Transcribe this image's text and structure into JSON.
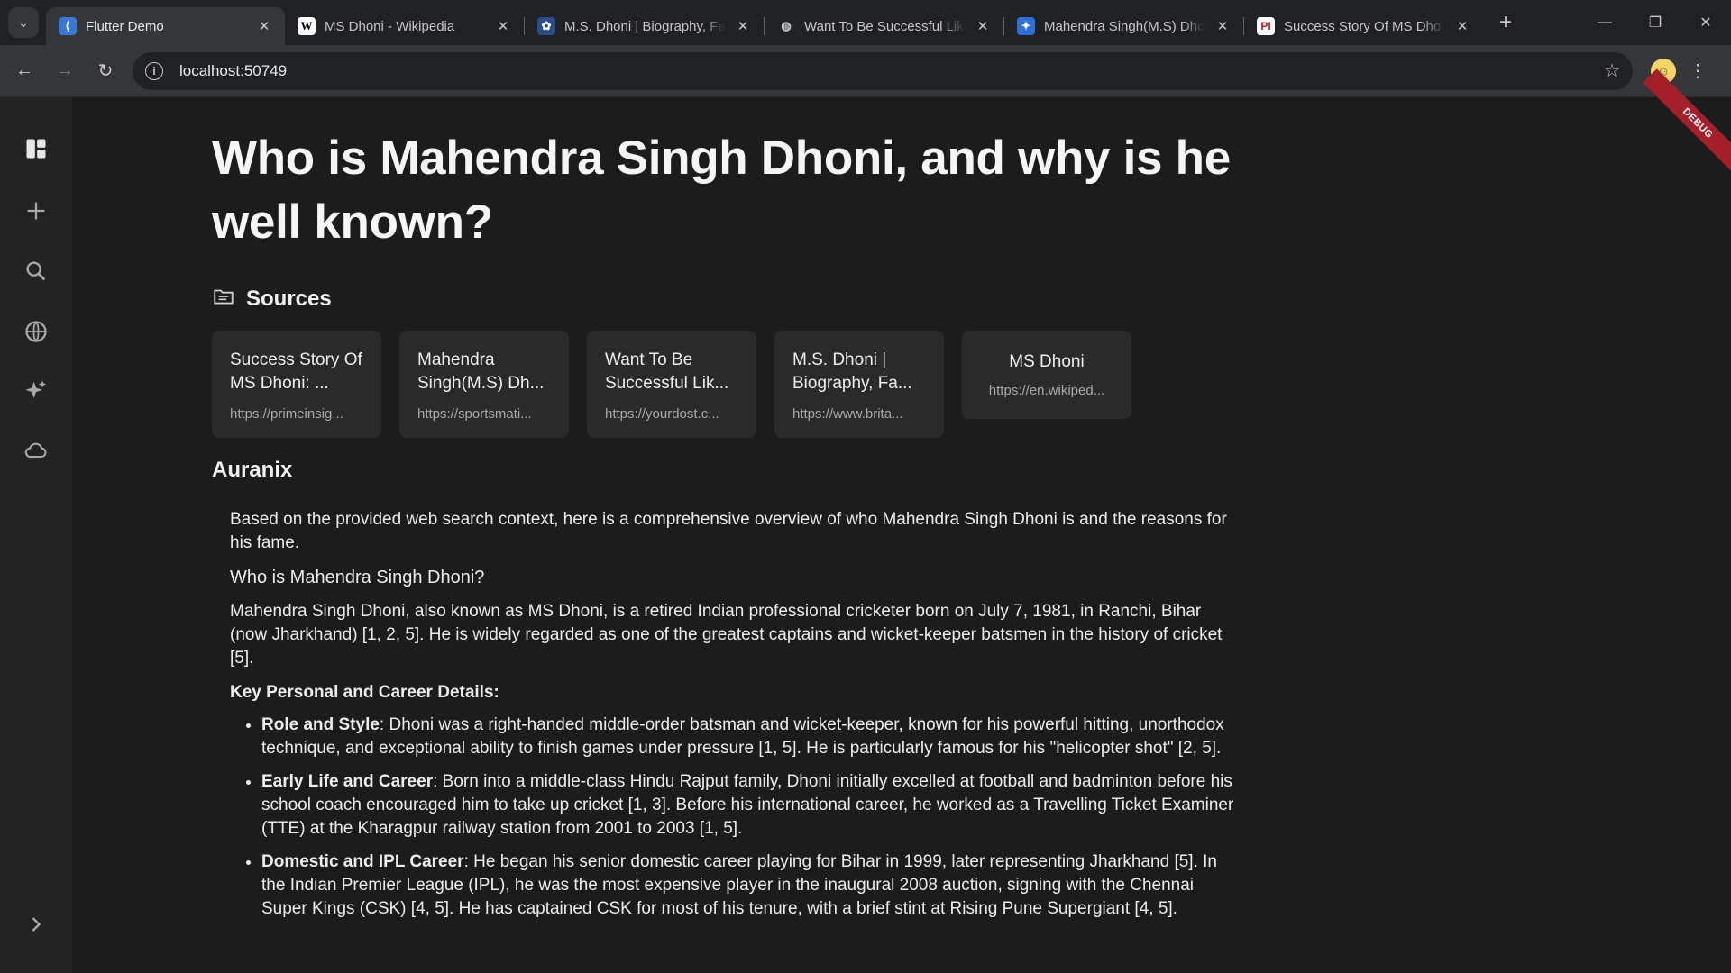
{
  "browser": {
    "tabs": [
      {
        "title": "Flutter Demo",
        "favicon": "flutter-icon",
        "active": true
      },
      {
        "title": "MS Dhoni - Wikipedia",
        "favicon": "wikipedia-icon",
        "active": false
      },
      {
        "title": "M.S. Dhoni | Biography, Facts",
        "favicon": "britannica-icon",
        "active": false
      },
      {
        "title": "Want To Be Successful Like",
        "favicon": "globe-icon",
        "active": false
      },
      {
        "title": "Mahendra Singh(M.S) Dhoni",
        "favicon": "sportsmatik-icon",
        "active": false
      },
      {
        "title": "Success Story Of MS Dhoni",
        "favicon": "primeinsights-icon",
        "active": false
      }
    ],
    "url": "localhost:50749"
  },
  "rail": {
    "icons": [
      "dashboard-icon",
      "plus-icon",
      "search-icon",
      "globe-icon",
      "sparkle-icon",
      "cloud-icon",
      "chevron-right-icon"
    ]
  },
  "debug_banner": "DEBUG",
  "page": {
    "question": "Who is Mahendra Singh Dhoni, and why is he well known?",
    "sources_label": "Sources",
    "sources": [
      {
        "title": "Success Story Of MS Dhoni: ...",
        "url": "https://primeinsig..."
      },
      {
        "title": "Mahendra Singh(M.S) Dh...",
        "url": "https://sportsmati..."
      },
      {
        "title": "Want To Be Successful Lik...",
        "url": "https://yourdost.c..."
      },
      {
        "title": "M.S. Dhoni | Biography, Fa...",
        "url": "https://www.brita..."
      },
      {
        "title": "MS Dhoni",
        "url": "https://en.wikiped..."
      }
    ],
    "assistant_name": "Auranix",
    "answer": {
      "intro": "Based on the provided web search context, here is a comprehensive overview of who Mahendra Singh Dhoni is and the reasons for his fame.",
      "heading": "Who is Mahendra Singh Dhoni?",
      "para": "Mahendra Singh Dhoni, also known as MS Dhoni, is a retired Indian professional cricketer born on July 7, 1981, in Ranchi, Bihar (now Jharkhand) [1, 2, 5]. He is widely regarded as one of the greatest captains and wicket-keeper batsmen in the history of cricket [5].",
      "key_details_label": "Key Personal and Career Details:",
      "bullets": [
        {
          "label": "Role and Style",
          "text": ": Dhoni was a right-handed middle-order batsman and wicket-keeper, known for his powerful hitting, unorthodox technique, and exceptional ability to finish games under pressure [1, 5]. He is particularly famous for his \"helicopter shot\" [2, 5]."
        },
        {
          "label": "Early Life and Career",
          "text": ": Born into a middle-class Hindu Rajput family, Dhoni initially excelled at football and badminton before his school coach encouraged him to take up cricket [1, 3]. Before his international career, he worked as a Travelling Ticket Examiner (TTE) at the Kharagpur railway station from 2001 to 2003 [1, 5]."
        },
        {
          "label": "Domestic and IPL Career",
          "text": ": He began his senior domestic career playing for Bihar in 1999, later representing Jharkhand [5]. In the Indian Premier League (IPL), he was the most expensive player in the inaugural 2008 auction, signing with the Chennai Super Kings (CSK) [4, 5]. He has captained CSK for most of his tenure, with a brief stint at Rising Pune Supergiant [4, 5]."
        }
      ]
    }
  },
  "colors": {
    "background": "#1c1c1c",
    "rail": "#232323",
    "card": "#2a2a2a",
    "debug_ribbon": "#a3202a"
  }
}
